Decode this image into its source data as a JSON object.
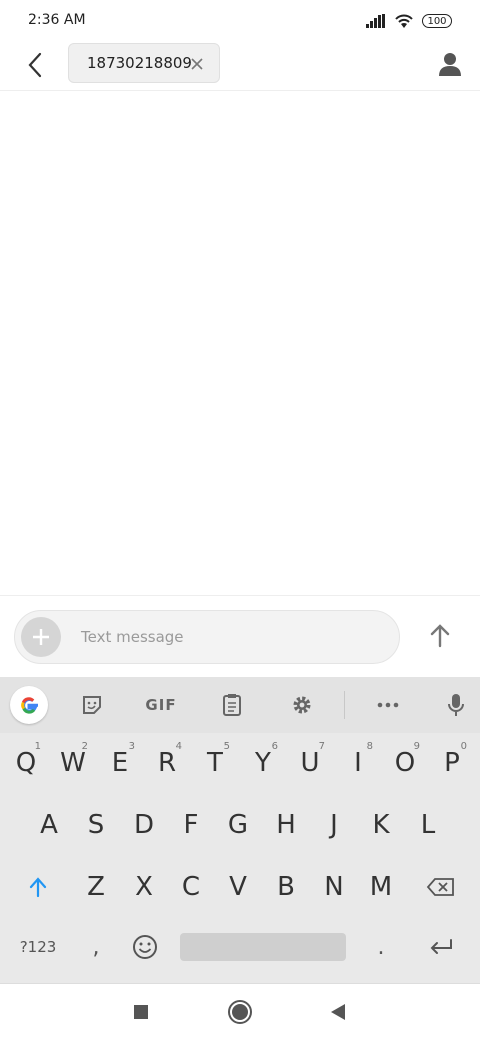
{
  "status": {
    "time": "2:36 AM",
    "battery": "100"
  },
  "header": {
    "recipient": "18730218809"
  },
  "composer": {
    "placeholder": "Text message"
  },
  "keyboard": {
    "row1": [
      {
        "k": "Q",
        "h": "1"
      },
      {
        "k": "W",
        "h": "2"
      },
      {
        "k": "E",
        "h": "3"
      },
      {
        "k": "R",
        "h": "4"
      },
      {
        "k": "T",
        "h": "5"
      },
      {
        "k": "Y",
        "h": "6"
      },
      {
        "k": "U",
        "h": "7"
      },
      {
        "k": "I",
        "h": "8"
      },
      {
        "k": "O",
        "h": "9"
      },
      {
        "k": "P",
        "h": "0"
      }
    ],
    "row2": [
      "A",
      "S",
      "D",
      "F",
      "G",
      "H",
      "J",
      "K",
      "L"
    ],
    "row3": [
      "Z",
      "X",
      "C",
      "V",
      "B",
      "N",
      "M"
    ],
    "symbols_label": "?123",
    "comma": ",",
    "period": ".",
    "gif_label": "GIF"
  },
  "colors": {
    "accent": "#1a73e8",
    "shift": "#2196f3"
  }
}
